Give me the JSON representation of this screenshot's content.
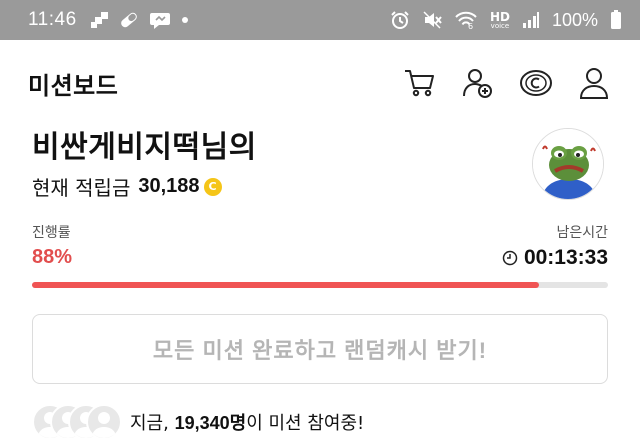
{
  "status_bar": {
    "time": "11:46",
    "battery": "100%",
    "left_icons": [
      "grid-app-icon",
      "pill-icon",
      "chat-bubble-icon",
      "dot-icon"
    ],
    "right_icons": [
      "alarm-icon",
      "mute-icon",
      "wifi-6-icon",
      "hd-voice-icon",
      "signal-icon",
      "battery-icon"
    ],
    "hd_label": "HD",
    "hd_sub": "voice"
  },
  "header": {
    "title": "미션보드",
    "actions": [
      "cart-icon",
      "add-friend-icon",
      "coin-shop-icon",
      "user-icon"
    ]
  },
  "profile": {
    "username": "비싼게비지떡님의",
    "points_label": "현재 적립금",
    "points_value": "30,188",
    "coin_symbol": "C"
  },
  "progress": {
    "label": "진행률",
    "percent_text": "88%",
    "percent": 88,
    "remaining_label": "남은시간",
    "remaining_time": "00:13:33"
  },
  "claim_button": {
    "label": "모든 미션 완료하고 랜덤캐시 받기!"
  },
  "participants": {
    "prefix": "지금, ",
    "count": "19,340명",
    "suffix": "이 미션 참여중!"
  },
  "colors": {
    "accent": "#f05454",
    "percent_text": "#e24e4e",
    "coin": "#f5c518",
    "status_bar": "#9a9a9a"
  }
}
